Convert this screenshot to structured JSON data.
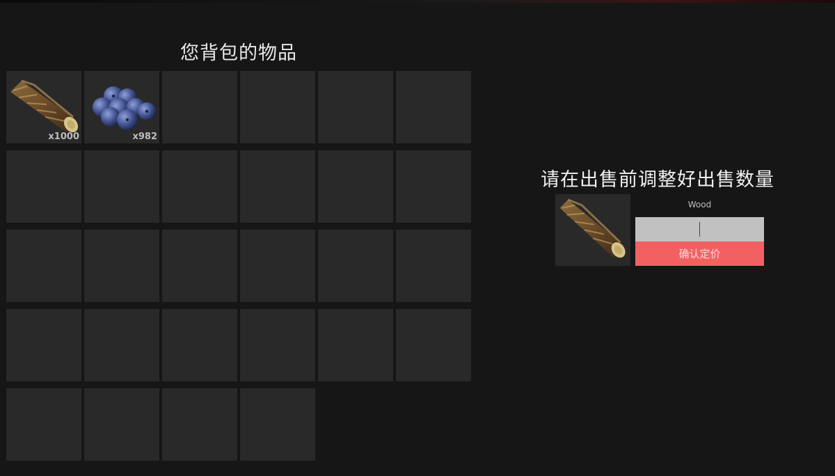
{
  "inventory": {
    "title": "您背包的物品",
    "slots": [
      {
        "item": "Wood",
        "icon": "wood-log-icon",
        "quantity": "x1000"
      },
      {
        "item": "Blueberries",
        "icon": "blueberries-icon",
        "quantity": "x982"
      }
    ],
    "total_slots": 30
  },
  "sell_panel": {
    "title": "请在出售前调整好出售数量",
    "item_name": "Wood",
    "item_icon": "wood-log-icon",
    "quantity_input_value": "",
    "confirm_label": "确认定价"
  },
  "colors": {
    "background": "#161616",
    "slot": "#292929",
    "input": "#c1c1c1",
    "confirm_button": "#f36062"
  }
}
